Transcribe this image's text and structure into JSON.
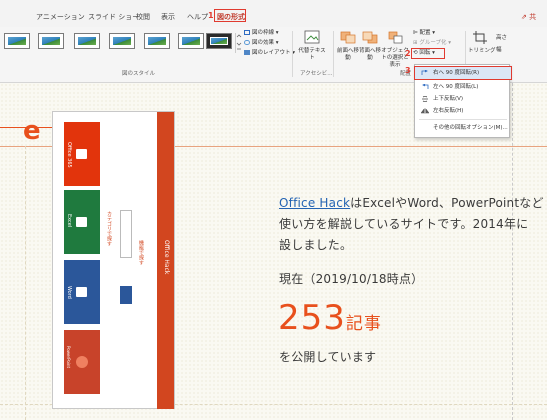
{
  "ribbon_tabs": [
    "アニメーション",
    "スライド ショー",
    "校閲",
    "表示",
    "ヘルプ"
  ],
  "active_tab": "図の形式",
  "step_marks": [
    "1",
    "2",
    "3"
  ],
  "share_label": "⇗ 共",
  "picture_styles": {
    "group_label": "図のスタイル",
    "border": "図の枠線",
    "effects": "図の効果",
    "layout": "図のレイアウト"
  },
  "accessibility": {
    "alt_text": "代替テキスト",
    "group_label": "アクセシビ..."
  },
  "arrange": {
    "bring_forward": "前面へ移動",
    "send_backward": "背面へ移動",
    "selection_pane": "オブジェクトの選択と表示",
    "align": "配置",
    "group": "グループ化",
    "rotate": "回転",
    "group_label": "配置"
  },
  "size": {
    "crop": "トリミング",
    "height_short": "高さ",
    "width_short": "幅"
  },
  "rotate_menu": {
    "items": [
      "右へ 90 度回転(R)",
      "左へ 90 度回転(L)",
      "上下反転(V)",
      "左右反転(H)",
      "その他の回転オプション(M)..."
    ]
  },
  "slide": {
    "title_fragment": "e",
    "line1_link": "Office Hack",
    "line1_rest": "はExcelやWord、PowerPointなど",
    "line2": "使い方を解説しているサイトです。2014年に",
    "line3": "設しました。",
    "date_line": "現在（2019/10/18時点）",
    "count": "253",
    "count_unit": "記事",
    "published": "を公開しています"
  },
  "inserted_image": {
    "apps": [
      "Office 365",
      "Excel",
      "Word",
      "PowerPoint"
    ],
    "vertical_caption_1": "カテゴリで探す",
    "vertical_caption_2": "機能で探す",
    "band_label": "Office Hack"
  },
  "colors": {
    "accent": "#e8501c",
    "highlight": "#e03a2f",
    "link": "#2464b3",
    "office365": "#e2340c",
    "excel": "#1f7a3e",
    "word": "#2b579a",
    "powerpoint": "#c8432a"
  }
}
